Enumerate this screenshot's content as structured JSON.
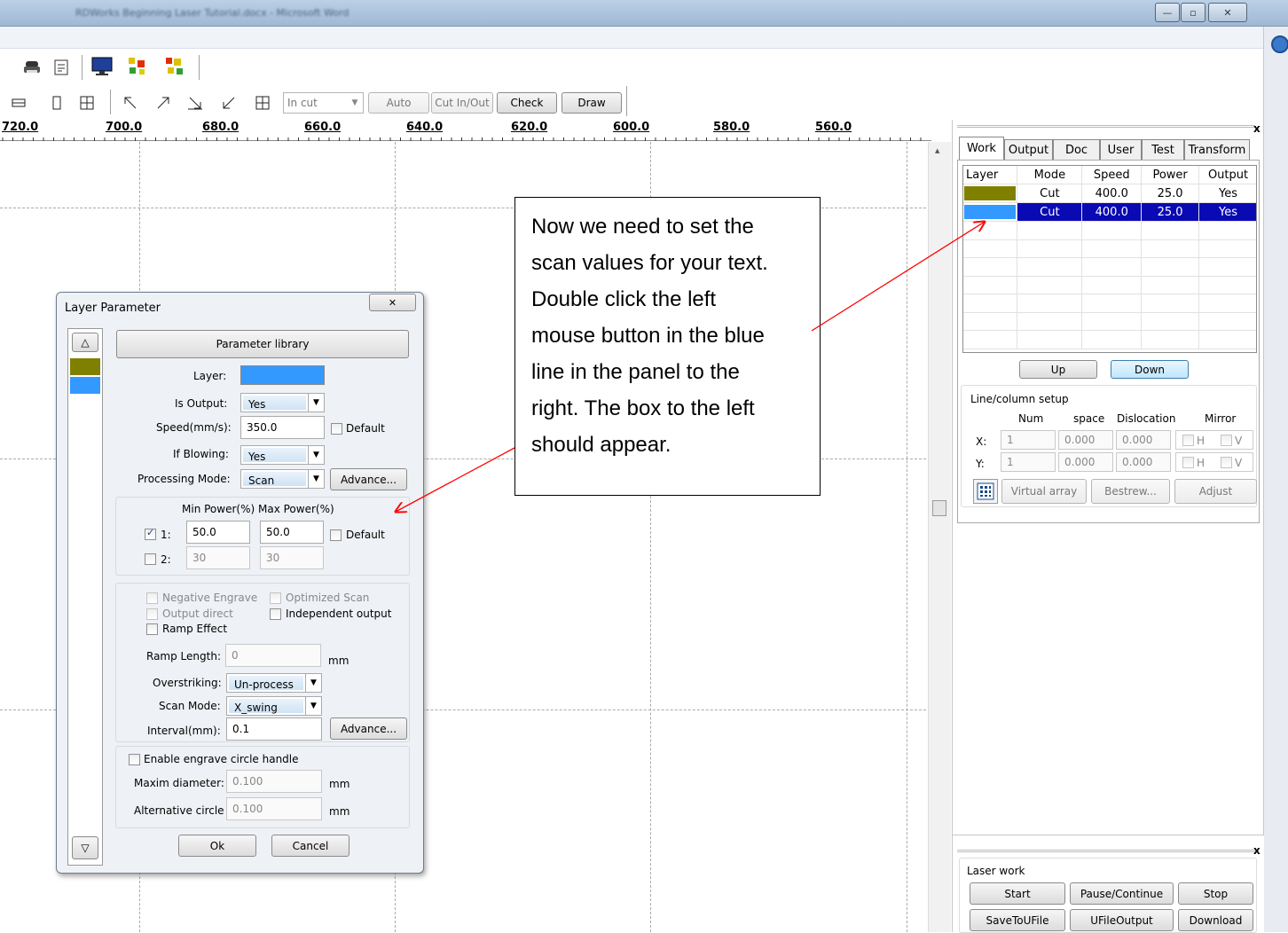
{
  "window": {
    "title": "RDWorks Beginning Laser Tutorial.docx - Microsoft Word",
    "min_btn": "—",
    "max_btn": "▫",
    "close_btn": "✕"
  },
  "toolbar2": {
    "mode_select": "In cut",
    "auto_button": "Auto",
    "cut_inout_button": "Cut In/Out",
    "check_button": "Check",
    "draw_button": "Draw"
  },
  "ruler": {
    "labels": [
      "720.0",
      "700.0",
      "680.0",
      "660.0",
      "640.0",
      "620.0",
      "600.0",
      "580.0",
      "560.0"
    ]
  },
  "right_panel": {
    "close": "x",
    "tabs": [
      "Work",
      "Output",
      "Doc",
      "User",
      "Test",
      "Transform"
    ],
    "layers_table": {
      "headers": [
        "Layer",
        "Mode",
        "Speed",
        "Power",
        "Output"
      ],
      "rows": [
        {
          "color": "#808000",
          "mode": "Cut",
          "speed": "400.0",
          "power": "25.0",
          "output": "Yes"
        },
        {
          "color": "#3399ff",
          "mode": "Cut",
          "speed": "400.0",
          "power": "25.0",
          "output": "Yes"
        }
      ]
    },
    "up_button": "Up",
    "down_button": "Down",
    "line_column": {
      "title": "Line/column setup",
      "headers": [
        "Num",
        "space",
        "Dislocation",
        "Mirror"
      ],
      "x_label": "X:",
      "y_label": "Y:",
      "x": {
        "num": "1",
        "space": "0.000",
        "dislocation": "0.000"
      },
      "y": {
        "num": "1",
        "space": "0.000",
        "dislocation": "0.000"
      },
      "mirror_h": "H",
      "mirror_v": "V",
      "virtual_array": "Virtual array",
      "bestrew": "Bestrew...",
      "adjust": "Adjust"
    },
    "laser_work": {
      "close": "x",
      "title": "Laser work",
      "start": "Start",
      "pause": "Pause/Continue",
      "stop": "Stop",
      "save": "SaveToUFile",
      "ufile": "UFileOutput",
      "download": "Download"
    }
  },
  "dialog": {
    "title": "Layer Parameter",
    "close": "✕",
    "param_library": "Parameter library",
    "layer_label": "Layer:",
    "layer_color": "#3399ff",
    "is_output_label": "Is Output:",
    "is_output": "Yes",
    "speed_label": "Speed(mm/s):",
    "speed": "350.0",
    "default_label": "Default",
    "if_blowing_label": "If Blowing:",
    "if_blowing": "Yes",
    "processing_mode_label": "Processing Mode:",
    "processing_mode": "Scan",
    "advance_button": "Advance...",
    "min_power_header": "Min Power(%)",
    "max_power_header": "Max Power(%)",
    "power1_label": "1:",
    "power1_min": "50.0",
    "power1_max": "50.0",
    "power2_label": "2:",
    "power2_min": "30",
    "power2_max": "30",
    "negative_engrave": "Negative Engrave",
    "optimized_scan": "Optimized Scan",
    "output_direct": "Output direct",
    "independent_output": "Independent output",
    "ramp_effect": "Ramp Effect",
    "ramp_length_label": "Ramp Length:",
    "ramp_length": "0",
    "mm": "mm",
    "overstriking_label": "Overstriking:",
    "overstriking": "Un-process",
    "scan_mode_label": "Scan Mode:",
    "scan_mode": "X_swing",
    "interval_label": "Interval(mm):",
    "interval": "0.1",
    "enable_circle": "Enable engrave circle handle",
    "maxim_diameter_label": "Maxim diameter:",
    "maxim_diameter": "0.100",
    "alt_circle_label": "Alternative circle",
    "alt_circle": "0.100",
    "ok": "Ok",
    "cancel": "Cancel",
    "layer_swatches": [
      "#808000",
      "#3399ff"
    ]
  },
  "callout": {
    "lines": [
      "Now we need to set the",
      "scan values for your text.",
      "Double click the left",
      "mouse button in the blue",
      "line in the panel to the",
      "right.  The box to the left",
      "should appear."
    ]
  },
  "colors": {
    "annotation_arrow": "#ff0000",
    "selected_row": "#0a0ab4"
  }
}
